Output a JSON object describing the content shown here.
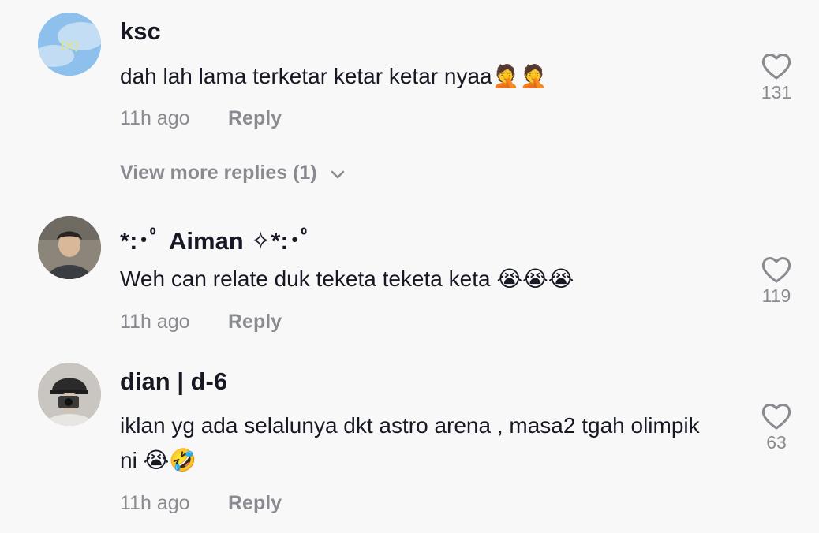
{
  "comments": [
    {
      "username": "ksc",
      "text": "dah lah lama terketar ketar ketar nyaa🤦🤦",
      "time": "11h ago",
      "reply_label": "Reply",
      "likes": "131",
      "avatar_text": "DQ",
      "avatar_color": "#8ec1ec"
    },
    {
      "username": "*:･ﾟ Aiman ✧*:･ﾟ",
      "text": "Weh can relate duk teketa teketa keta 😭😭😭",
      "time": "11h ago",
      "reply_label": "Reply",
      "likes": "119",
      "avatar_color": "#7d7568"
    },
    {
      "username": "dian | d-6",
      "text": "iklan yg ada selalunya dkt astro arena , masa2 tgah olimpik ni 😭🤣",
      "time": "11h ago",
      "reply_label": "Reply",
      "likes": "63",
      "avatar_color": "#b9b5b0"
    }
  ],
  "view_more": {
    "label": "View more replies (1)"
  },
  "colors": {
    "muted": "#8a8b91",
    "text": "#161823",
    "background": "#f8f8f8"
  }
}
